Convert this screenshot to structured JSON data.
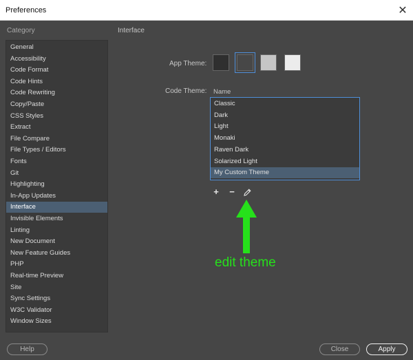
{
  "window": {
    "title": "Preferences"
  },
  "sidebar": {
    "label": "Category",
    "items": [
      {
        "label": "General"
      },
      {
        "label": "Accessibility"
      },
      {
        "label": "Code Format"
      },
      {
        "label": "Code Hints"
      },
      {
        "label": "Code Rewriting"
      },
      {
        "label": "Copy/Paste"
      },
      {
        "label": "CSS Styles"
      },
      {
        "label": "Extract"
      },
      {
        "label": "File Compare"
      },
      {
        "label": "File Types / Editors"
      },
      {
        "label": "Fonts"
      },
      {
        "label": "Git"
      },
      {
        "label": "Highlighting"
      },
      {
        "label": "In-App Updates"
      },
      {
        "label": "Interface"
      },
      {
        "label": "Invisible Elements"
      },
      {
        "label": "Linting"
      },
      {
        "label": "New Document"
      },
      {
        "label": "New Feature Guides"
      },
      {
        "label": "PHP"
      },
      {
        "label": "Real-time Preview"
      },
      {
        "label": "Site"
      },
      {
        "label": "Sync Settings"
      },
      {
        "label": "W3C Validator"
      },
      {
        "label": "Window Sizes"
      }
    ],
    "selected_index": 14
  },
  "main": {
    "section_title": "Interface",
    "app_theme": {
      "label": "App Theme:",
      "swatches": [
        {
          "color": "#2f2f2f"
        },
        {
          "color": "#474747"
        },
        {
          "color": "#c6c6c6"
        },
        {
          "color": "#ececec"
        }
      ],
      "selected_index": 1
    },
    "code_theme": {
      "label": "Code Theme:",
      "column_header": "Name",
      "items": [
        {
          "label": "Classic"
        },
        {
          "label": "Dark"
        },
        {
          "label": "Light"
        },
        {
          "label": "Monaki"
        },
        {
          "label": "Raven Dark"
        },
        {
          "label": "Solarized Light"
        },
        {
          "label": "My Custom Theme"
        }
      ],
      "selected_index": 6
    },
    "list_buttons": {
      "add": "+",
      "remove": "−",
      "edit_icon": "pencil-icon"
    },
    "annotation": {
      "text": "edit theme",
      "color": "#26e01b"
    }
  },
  "footer": {
    "help": "Help",
    "close": "Close",
    "apply": "Apply"
  }
}
